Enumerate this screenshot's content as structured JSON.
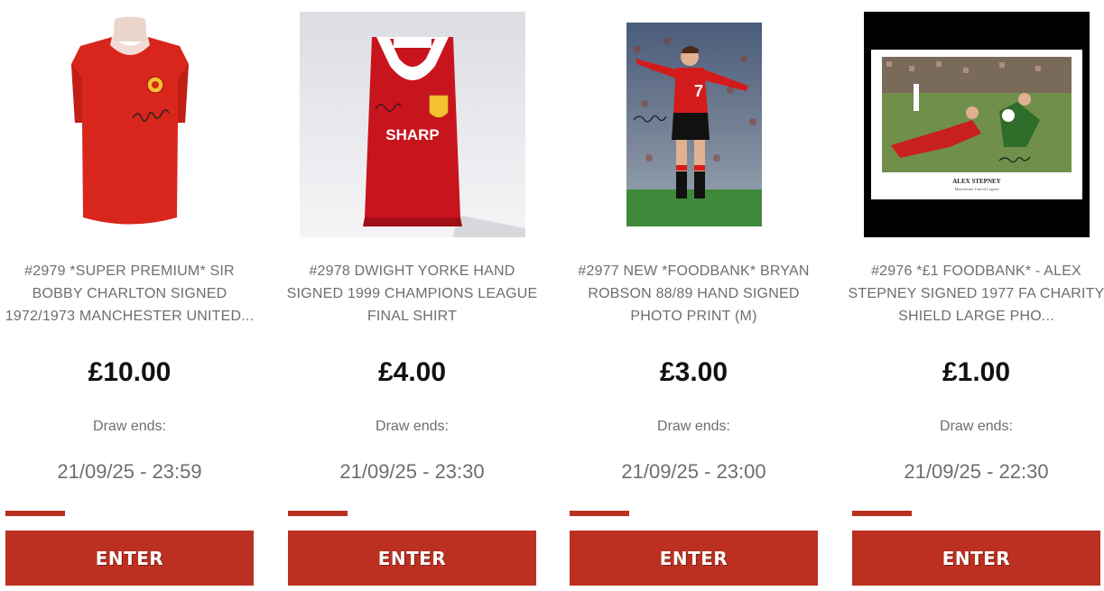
{
  "colors": {
    "accent": "#bb3021",
    "text_muted": "#6e6e6e",
    "price": "#111111"
  },
  "competitions": [
    {
      "title": "#2979 *SUPER PREMIUM* SIR BOBBY CHARLTON SIGNED 1972/1973 MANCHESTER UNITED...",
      "price": "£10.00",
      "draw_label": "Draw ends:",
      "draw_date": "21/09/25 - 23:59",
      "progress": 0.24,
      "button": "ENTER",
      "image": "signed-red-retro-shirt"
    },
    {
      "title": "#2978 DWIGHT YORKE HAND SIGNED 1999 CHAMPIONS LEAGUE FINAL SHIRT",
      "price": "£4.00",
      "draw_label": "Draw ends:",
      "draw_date": "21/09/25 - 23:30",
      "progress": 0.24,
      "button": "ENTER",
      "image": "signed-red-sharp-shirt",
      "shirt_text": "SHARP"
    },
    {
      "title": "#2977 NEW *FOODBANK* BRYAN ROBSON 88/89 HAND SIGNED PHOTO PRINT (M)",
      "price": "£3.00",
      "draw_label": "Draw ends:",
      "draw_date": "21/09/25 - 23:00",
      "progress": 0.24,
      "button": "ENTER",
      "image": "signed-player-photo",
      "shirt_number": "7"
    },
    {
      "title": "#2976 *£1 FOODBANK* - ALEX STEPNEY SIGNED 1977 FA CHARITY SHIELD LARGE PHO...",
      "price": "£1.00",
      "draw_label": "Draw ends:",
      "draw_date": "21/09/25 - 22:30",
      "progress": 0.24,
      "button": "ENTER",
      "image": "signed-match-photo-framed",
      "print_caption": "ALEX STEPNEY",
      "print_subcaption": "Manchester United Legend"
    }
  ]
}
